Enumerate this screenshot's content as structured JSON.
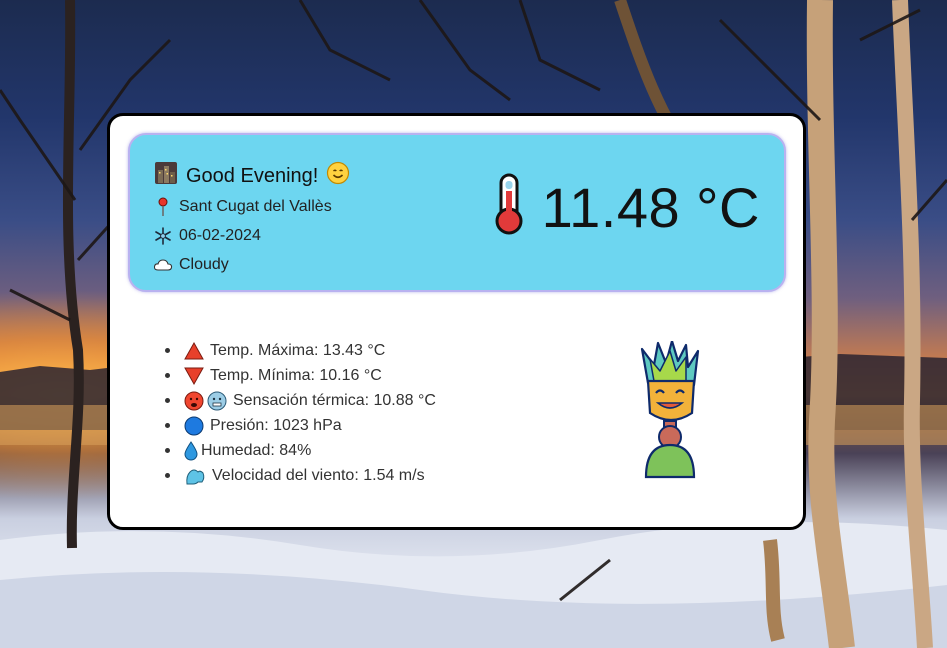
{
  "header": {
    "greeting": "Good Evening!",
    "location": "Sant Cugat del Vallès",
    "date": "06-02-2024",
    "condition": "Cloudy",
    "temperature": "11.48 °C"
  },
  "details": [
    {
      "icon": "triangle-up-icon",
      "label": "Temp. Máxima: 13.43 °C"
    },
    {
      "icon": "triangle-down-icon",
      "label": "Temp. Mínima: 10.16 °C"
    },
    {
      "icon": "hot-cold-face-icon",
      "label": "Sensación térmica: 10.88 °C"
    },
    {
      "icon": "blue-circle-icon",
      "label": "Presión: 1023 hPa"
    },
    {
      "icon": "droplet-icon",
      "label": "Humedad: 84%"
    },
    {
      "icon": "wind-icon",
      "label": "Velocidad del viento: 1.54 m/s"
    }
  ],
  "colors": {
    "panel": "#6dd6f0",
    "card": "#ffffff",
    "border": "#000000"
  }
}
